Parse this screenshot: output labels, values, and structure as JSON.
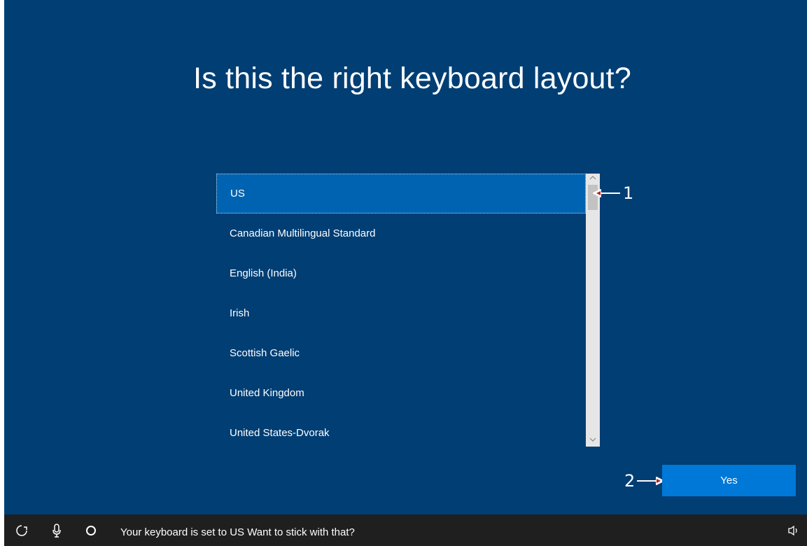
{
  "page": {
    "title": "Is this the right keyboard layout?",
    "background_color": "#003e74"
  },
  "layout_list": {
    "items": [
      {
        "label": "US",
        "selected": true
      },
      {
        "label": "Canadian Multilingual Standard",
        "selected": false
      },
      {
        "label": "English (India)",
        "selected": false
      },
      {
        "label": "Irish",
        "selected": false
      },
      {
        "label": "Scottish Gaelic",
        "selected": false
      },
      {
        "label": "United Kingdom",
        "selected": false
      },
      {
        "label": "United States-Dvorak",
        "selected": false
      }
    ],
    "selection_color": "#0063b1"
  },
  "annotations": {
    "marker_1": "1",
    "marker_2": "2"
  },
  "actions": {
    "yes_label": "Yes",
    "accent_color": "#0078d7"
  },
  "taskbar": {
    "status_text": "Your keyboard is set to US Want to stick with that?",
    "icons": [
      "ease-of-access-icon",
      "microphone-icon",
      "cortana-icon",
      "volume-icon"
    ]
  }
}
